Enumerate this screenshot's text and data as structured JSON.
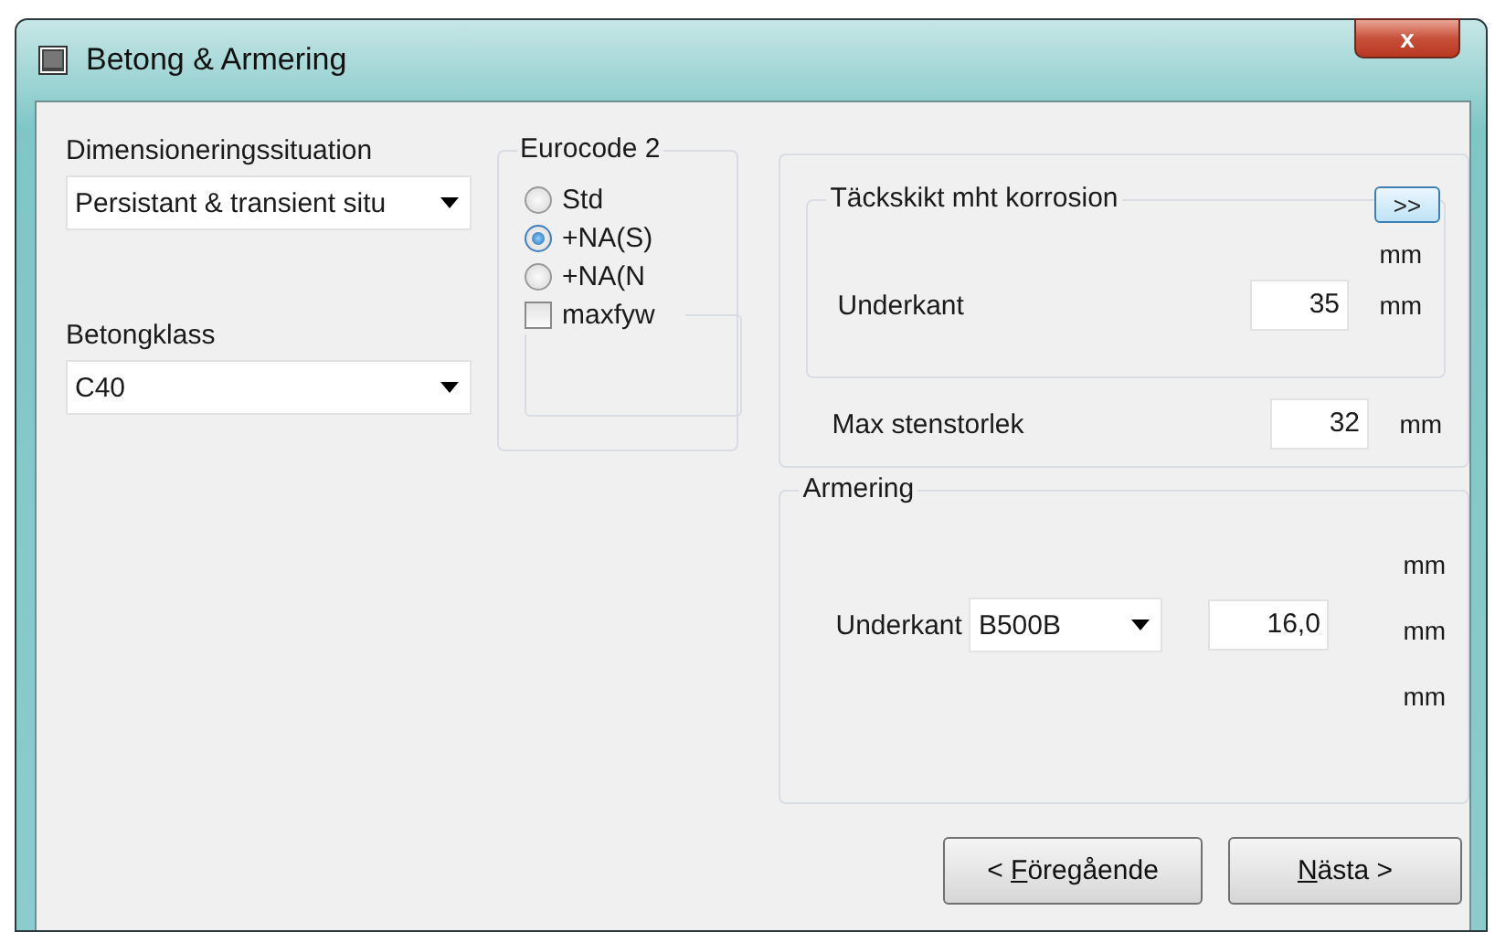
{
  "window": {
    "title": "Betong & Armering",
    "close": "x"
  },
  "situation": {
    "label": "Dimensioneringssituation",
    "value": "Persistant & transient situ"
  },
  "concrete": {
    "label": "Betongklass",
    "value": "C40"
  },
  "eurocode": {
    "title": "Eurocode 2",
    "options": [
      {
        "label": "Std",
        "selected": false
      },
      {
        "label": "+NA(S)",
        "selected": true
      },
      {
        "label": "+NA(N",
        "selected": false
      }
    ],
    "maxfyw": {
      "label": "maxfyw",
      "checked": false
    }
  },
  "cover": {
    "title": "Täckskikt mht korrosion",
    "expand_button": ">>",
    "top_unit": "mm",
    "label": "Underkant",
    "value": "35",
    "unit": "mm"
  },
  "max_aggregate": {
    "label": "Max stenstorlek",
    "value": "32",
    "unit": "mm"
  },
  "reinforcement": {
    "title": "Armering",
    "label": "Underkant",
    "grade": "B500B",
    "diameter": "16,0",
    "units": [
      "mm",
      "mm",
      "mm"
    ]
  },
  "buttons": [
    {
      "before": "< ",
      "key": "F",
      "after": "öregående"
    },
    {
      "key": "N",
      "after": "ästa >"
    }
  ]
}
